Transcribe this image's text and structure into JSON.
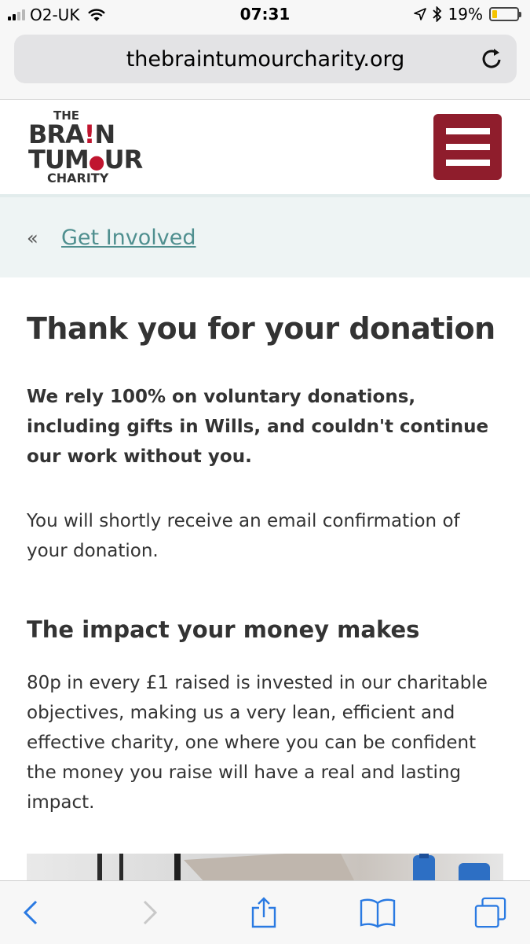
{
  "status_bar": {
    "carrier": "O2-UK",
    "time": "07:31",
    "battery_percent": "19%",
    "battery_level": 0.19,
    "signal_bars": 2
  },
  "browser": {
    "url": "thebraintumourcharity.org"
  },
  "site": {
    "logo": {
      "line1": "THE",
      "line2_a": "BRA",
      "line2_b": "!",
      "line2_c": "N",
      "line3_a": "TUM",
      "line3_b": "●",
      "line3_c": "UR",
      "line4": "CHARITY"
    },
    "brand_color": "#8f1d2c"
  },
  "breadcrumb": {
    "back_symbol": "«",
    "link_label": "Get Involved"
  },
  "main": {
    "title": "Thank you for your donation",
    "lead": "We rely 100% on voluntary donations, including gifts in Wills, and couldn't continue our work without you.",
    "confirmation": "You will shortly receive an email confirmation of your donation.",
    "impact_heading": "The impact your money makes",
    "impact_text": "80p in every £1 raised is invested in our charitable objectives, making us a very lean, efficient and effective charity, one where you can be confident the money you raise will have a real and lasting impact."
  }
}
